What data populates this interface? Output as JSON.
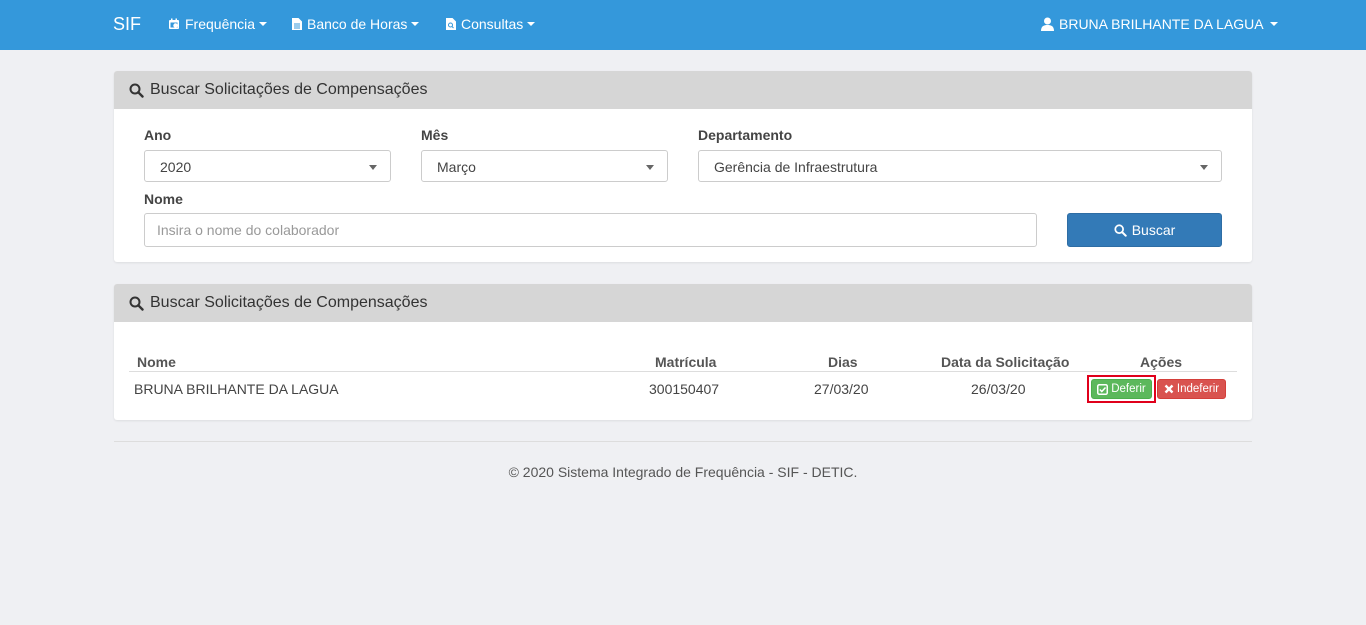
{
  "navbar": {
    "brand": "SIF",
    "menus": [
      {
        "label": "Frequência"
      },
      {
        "label": "Banco de Horas"
      },
      {
        "label": "Consultas"
      }
    ],
    "user": "BRUNA BRILHANTE DA LAGUA",
    "background": "#3498db"
  },
  "search_panel": {
    "title": "Buscar Solicitações de Compensações",
    "ano_label": "Ano",
    "ano_value": "2020",
    "mes_label": "Mês",
    "mes_value": "Março",
    "departamento_label": "Departamento",
    "departamento_value": "Gerência de Infraestrutura",
    "nome_label": "Nome",
    "nome_placeholder": "Insira o nome do colaborador",
    "search_button": "Buscar"
  },
  "results_panel": {
    "title": "Buscar Solicitações de Compensações",
    "columns": [
      "Nome",
      "Matrícula",
      "Dias",
      "Data da Solicitação",
      "Ações"
    ],
    "rows": [
      {
        "nome": "BRUNA BRILHANTE DA LAGUA",
        "matricula": "300150407",
        "dias": "27/03/20",
        "data_solicitacao": "26/03/20",
        "approve_label": "Deferir",
        "reject_label": "Indeferir"
      }
    ]
  },
  "footer": {
    "text": "© 2020 Sistema Integrado de Frequência - SIF - DETIC."
  },
  "colors": {
    "primary": "#337ab7",
    "success": "#5cb85c",
    "danger": "#d9534f",
    "highlight": "#e0001b"
  }
}
